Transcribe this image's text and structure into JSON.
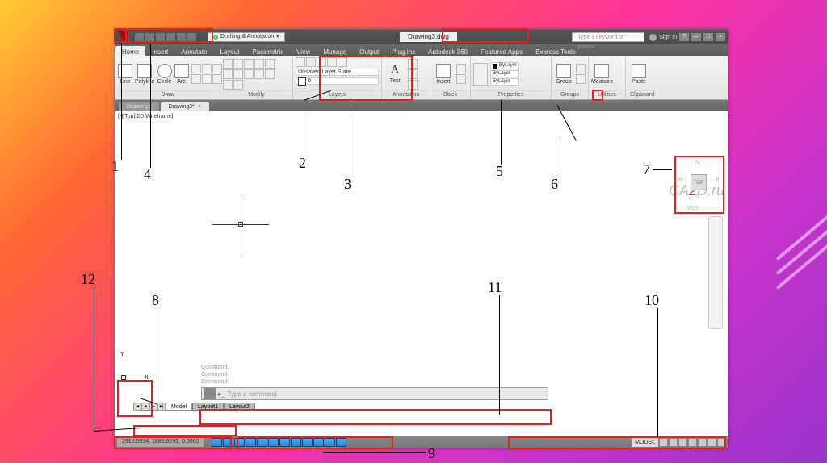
{
  "title_bar": {
    "workspace": "Drafting & Annotation",
    "document": "Drawing3.dwg",
    "search_placeholder": "Type a keyword or phrase",
    "signin": "Sign In"
  },
  "ribbon_tabs": [
    "Home",
    "Insert",
    "Annotate",
    "Layout",
    "Parametric",
    "View",
    "Manage",
    "Output",
    "Plug-ins",
    "Autodesk 360",
    "Featured Apps",
    "Express Tools"
  ],
  "panels": {
    "draw": {
      "title": "Draw",
      "line": "Line",
      "polyline": "Polyline",
      "circle": "Circle",
      "arc": "Arc"
    },
    "modify": {
      "title": "Modify"
    },
    "layers": {
      "title": "Layers",
      "state": "Unsaved Layer State",
      "current": "0"
    },
    "annotation": {
      "title": "Annotation",
      "text": "Text"
    },
    "block": {
      "title": "Block",
      "insert": "Insert"
    },
    "properties": {
      "title": "Properties",
      "bylayer": "ByLayer"
    },
    "groups": {
      "title": "Groups",
      "group": "Group"
    },
    "utilities": {
      "title": "Utilities",
      "measure": "Measure"
    },
    "clipboard": {
      "title": "Clipboard",
      "paste": "Paste"
    }
  },
  "doc_tabs": [
    {
      "label": "Drawing1"
    },
    {
      "label": "Drawing3*",
      "active": true
    }
  ],
  "view_label": "[‑][Top][2D Wireframe]",
  "viewcube": {
    "face": "TOP",
    "wcs": "WCS",
    "n": "N",
    "s": "S",
    "w": "W",
    "e": "E"
  },
  "ucs": {
    "x": "X",
    "y": "Y"
  },
  "command": {
    "history": [
      "Command:",
      "Command:",
      "Command:"
    ],
    "prompt": "Type a command"
  },
  "layout_tabs": [
    "Model",
    "Layout1",
    "Layout2"
  ],
  "status": {
    "coords": "2910.0034, 1886.9295, 0.0000",
    "model": "MODEL"
  },
  "watermark": {
    "text": "CA",
    "two": "2",
    "d": "D.ru"
  },
  "annotations": {
    "1": "1",
    "2": "2",
    "3": "3",
    "4": "4",
    "5": "5",
    "6": "6",
    "7": "7",
    "8": "8",
    "9": "9",
    "10": "10",
    "11": "11",
    "12": "12"
  }
}
